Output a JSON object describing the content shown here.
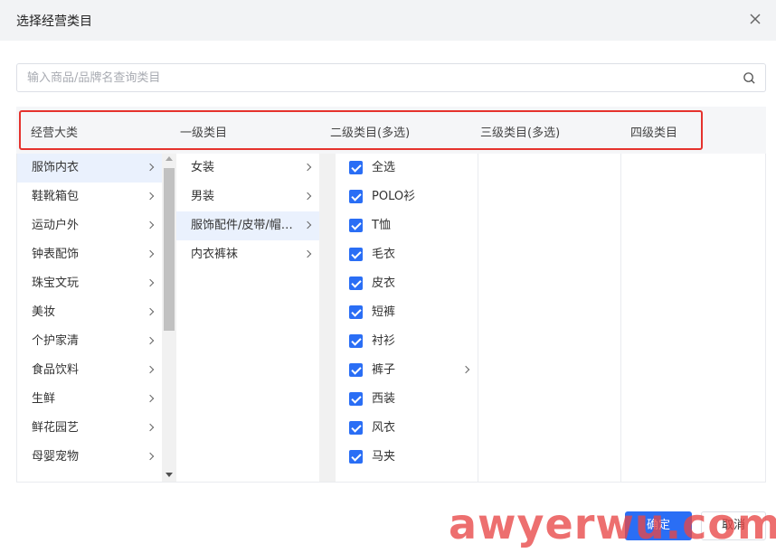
{
  "dialog": {
    "title": "选择经营类目"
  },
  "search": {
    "placeholder": "输入商品/品牌名查询类目",
    "value": ""
  },
  "headers": [
    "经营大类",
    "一级类目",
    "二级类目(多选)",
    "三级类目(多选)",
    "四级类目"
  ],
  "col1": [
    {
      "label": "服饰内衣",
      "active": true
    },
    {
      "label": "鞋靴箱包"
    },
    {
      "label": "运动户外"
    },
    {
      "label": "钟表配饰"
    },
    {
      "label": "珠宝文玩"
    },
    {
      "label": "美妆"
    },
    {
      "label": "个护家清"
    },
    {
      "label": "食品饮料"
    },
    {
      "label": "生鲜"
    },
    {
      "label": "鲜花园艺"
    },
    {
      "label": "母婴宠物"
    }
  ],
  "col2": [
    {
      "label": "女装"
    },
    {
      "label": "男装"
    },
    {
      "label": "服饰配件/皮带/帽子/围巾",
      "active": true
    },
    {
      "label": "内衣裤袜"
    }
  ],
  "col3": [
    {
      "label": "全选",
      "checked": true
    },
    {
      "label": "POLO衫",
      "checked": true
    },
    {
      "label": "T恤",
      "checked": true
    },
    {
      "label": "毛衣",
      "checked": true
    },
    {
      "label": "皮衣",
      "checked": true
    },
    {
      "label": "短裤",
      "checked": true
    },
    {
      "label": "衬衫",
      "checked": true
    },
    {
      "label": "裤子",
      "checked": true,
      "has_children": true
    },
    {
      "label": "西装",
      "checked": true
    },
    {
      "label": "风衣",
      "checked": true
    },
    {
      "label": "马夹",
      "checked": true
    }
  ],
  "footer": {
    "confirm_label": "确定",
    "cancel_label": "取消"
  },
  "watermark": "awyerwu.com",
  "colors": {
    "primary": "#2a6ef5",
    "highlight": "#e5322d",
    "active_bg": "#eaf1fd"
  }
}
